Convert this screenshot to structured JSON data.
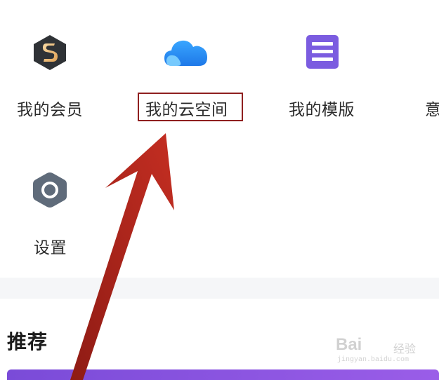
{
  "menu": {
    "items": [
      {
        "label": "我的会员",
        "icon": "vip-s-badge-icon"
      },
      {
        "label": "我的云空间",
        "icon": "cloud-icon"
      },
      {
        "label": "我的模版",
        "icon": "document-template-icon"
      },
      {
        "label": "意",
        "icon": "partial-icon"
      },
      {
        "label": "设置",
        "icon": "settings-hexagon-icon"
      }
    ]
  },
  "section": {
    "recommend_title": "推荐"
  },
  "watermark": {
    "brand": "Bai",
    "sub": "经验",
    "url": "jingyan.baidu.com"
  },
  "colors": {
    "highlight_border": "#8f1f1f",
    "arrow": "#b3261e",
    "cloud": "#2d8cf0",
    "template": "#7b5ce0",
    "settings": "#5f6b7a",
    "banner": "#8a55e2"
  }
}
